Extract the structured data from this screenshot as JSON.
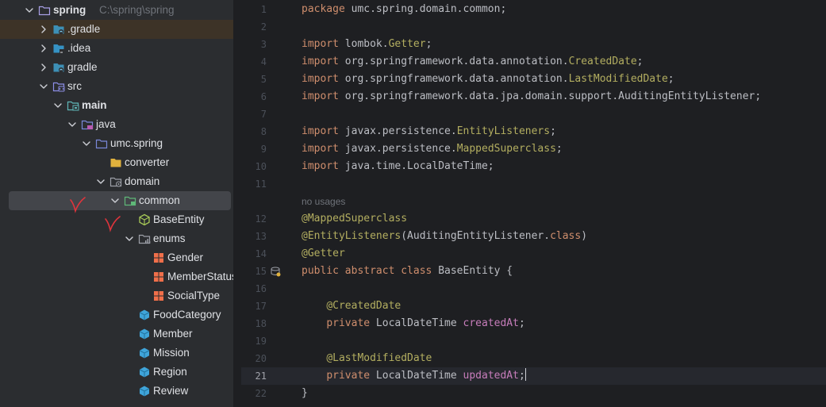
{
  "project_tree": {
    "rows": [
      {
        "label": "spring",
        "path": "C:\\spring\\spring",
        "bold": true,
        "icon": "folder-icon",
        "expanded": true
      },
      {
        "label": ".gradle",
        "icon": "folder-gradle-icon",
        "expanded": false,
        "selected": true
      },
      {
        "label": ".idea",
        "icon": "folder-idea-icon",
        "expanded": false
      },
      {
        "label": "gradle",
        "icon": "folder-gradle-icon",
        "expanded": false
      },
      {
        "label": "src",
        "icon": "folder-src-icon",
        "expanded": true
      },
      {
        "label": "main",
        "bold": true,
        "icon": "folder-module-icon",
        "expanded": true
      },
      {
        "label": "java",
        "icon": "folder-source-root-icon",
        "expanded": true
      },
      {
        "label": "umc.spring",
        "icon": "package-icon",
        "expanded": true
      },
      {
        "label": "converter",
        "icon": "folder-yellow-icon"
      },
      {
        "label": "domain",
        "icon": "package-gear-icon",
        "expanded": true
      },
      {
        "label": "common",
        "icon": "package-green-icon",
        "expanded": true,
        "focused": true
      },
      {
        "label": "BaseEntity",
        "icon": "abstract-class-icon"
      },
      {
        "label": "enums",
        "icon": "package-enum-icon",
        "expanded": true
      },
      {
        "label": "Gender",
        "icon": "enum-icon"
      },
      {
        "label": "MemberStatus",
        "icon": "enum-icon"
      },
      {
        "label": "SocialType",
        "icon": "enum-icon"
      },
      {
        "label": "FoodCategory",
        "icon": "class-icon"
      },
      {
        "label": "Member",
        "icon": "class-icon"
      },
      {
        "label": "Mission",
        "icon": "class-icon"
      },
      {
        "label": "Region",
        "icon": "class-icon"
      },
      {
        "label": "Review",
        "icon": "class-icon"
      }
    ]
  },
  "editor": {
    "usages_hint": "no usages",
    "current_line": "21",
    "lines": [
      {
        "n": "1",
        "tokens": [
          {
            "t": "package",
            "c": "kw"
          },
          {
            "t": " umc.spring.domain.common;"
          }
        ]
      },
      {
        "n": "2",
        "tokens": []
      },
      {
        "n": "3",
        "tokens": [
          {
            "t": "import",
            "c": "kw"
          },
          {
            "t": " lombok."
          },
          {
            "t": "Getter",
            "c": "ann"
          },
          {
            "t": ";"
          }
        ]
      },
      {
        "n": "4",
        "tokens": [
          {
            "t": "import",
            "c": "kw"
          },
          {
            "t": " org.springframework.data.annotation."
          },
          {
            "t": "CreatedDate",
            "c": "ann"
          },
          {
            "t": ";"
          }
        ]
      },
      {
        "n": "5",
        "tokens": [
          {
            "t": "import",
            "c": "kw"
          },
          {
            "t": " org.springframework.data.annotation."
          },
          {
            "t": "LastModifiedDate",
            "c": "ann"
          },
          {
            "t": ";"
          }
        ]
      },
      {
        "n": "6",
        "tokens": [
          {
            "t": "import",
            "c": "kw"
          },
          {
            "t": " org.springframework.data.jpa.domain.support.AuditingEntityListener;"
          }
        ]
      },
      {
        "n": "7",
        "tokens": []
      },
      {
        "n": "8",
        "tokens": [
          {
            "t": "import",
            "c": "kw"
          },
          {
            "t": " javax.persistence."
          },
          {
            "t": "EntityListeners",
            "c": "ann"
          },
          {
            "t": ";"
          }
        ]
      },
      {
        "n": "9",
        "tokens": [
          {
            "t": "import",
            "c": "kw"
          },
          {
            "t": " javax.persistence."
          },
          {
            "t": "MappedSuperclass",
            "c": "ann"
          },
          {
            "t": ";"
          }
        ]
      },
      {
        "n": "10",
        "tokens": [
          {
            "t": "import",
            "c": "kw"
          },
          {
            "t": " java.time.LocalDateTime;"
          }
        ]
      },
      {
        "n": "11",
        "tokens": []
      },
      {
        "n": "12",
        "tokens": [
          {
            "t": "@MappedSuperclass",
            "c": "ann"
          }
        ]
      },
      {
        "n": "13",
        "tokens": [
          {
            "t": "@EntityListeners",
            "c": "ann"
          },
          {
            "t": "(AuditingEntityListener."
          },
          {
            "t": "class",
            "c": "kw"
          },
          {
            "t": ")"
          }
        ]
      },
      {
        "n": "14",
        "tokens": [
          {
            "t": "@Getter",
            "c": "ann"
          }
        ]
      },
      {
        "n": "15",
        "tokens": [
          {
            "t": "public abstract class",
            "c": "kw"
          },
          {
            "t": " BaseEntity {"
          }
        ],
        "gutter_icon": "implemented-icon"
      },
      {
        "n": "16",
        "tokens": []
      },
      {
        "n": "17",
        "tokens": [
          {
            "t": "    "
          },
          {
            "t": "@CreatedDate",
            "c": "ann"
          }
        ]
      },
      {
        "n": "18",
        "tokens": [
          {
            "t": "    "
          },
          {
            "t": "private",
            "c": "kw"
          },
          {
            "t": " LocalDateTime "
          },
          {
            "t": "createdAt",
            "c": "fld"
          },
          {
            "t": ";"
          }
        ]
      },
      {
        "n": "19",
        "tokens": []
      },
      {
        "n": "20",
        "tokens": [
          {
            "t": "    "
          },
          {
            "t": "@LastModifiedDate",
            "c": "ann"
          }
        ]
      },
      {
        "n": "21",
        "tokens": [
          {
            "t": "    "
          },
          {
            "t": "private",
            "c": "kw"
          },
          {
            "t": " LocalDateTime "
          },
          {
            "t": "updatedAt",
            "c": "fld"
          },
          {
            "t": ";"
          }
        ]
      },
      {
        "n": "22",
        "tokens": [
          {
            "t": "}"
          }
        ]
      }
    ]
  },
  "colors": {
    "keyword": "#cf8e6d",
    "annotation": "#b3ae60",
    "field": "#c77dbb",
    "text": "#bcbec4",
    "tree_bg": "#2b2d30",
    "editor_bg": "#1e1f22",
    "selection": "#43454a",
    "file_selection": "#3d3327",
    "red_mark": "#e0343c"
  }
}
